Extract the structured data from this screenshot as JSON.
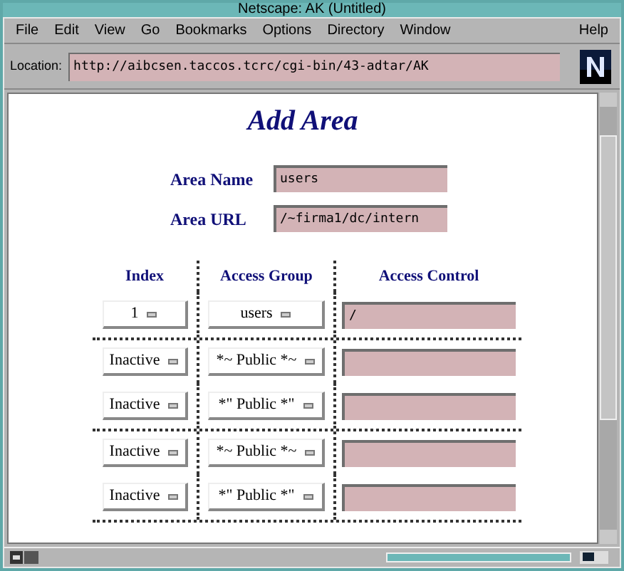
{
  "window": {
    "title": "Netscape: AK (Untitled)"
  },
  "menu": [
    "File",
    "Edit",
    "View",
    "Go",
    "Bookmarks",
    "Options",
    "Directory",
    "Window",
    "Help"
  ],
  "location": {
    "label": "Location:",
    "value": "http://aibcsen.taccos.tcrc/cgi-bin/43-adtar/AK"
  },
  "page": {
    "heading": "Add Area",
    "fields": [
      {
        "label": "Area Name",
        "value": "users"
      },
      {
        "label": "Area URL",
        "value": "/~firma1/dc/intern"
      }
    ],
    "table": {
      "columns": [
        "Index",
        "Access Group",
        "Access Control"
      ],
      "rows": [
        {
          "index": "1",
          "group": "users",
          "control": "/",
          "separator": false
        },
        {
          "index": "Inactive",
          "group": "*~ Public *~",
          "control": "",
          "separator": true
        },
        {
          "index": "Inactive",
          "group": "*\" Public *\"",
          "control": "",
          "separator": false
        },
        {
          "index": "Inactive",
          "group": "*~ Public *~",
          "control": "",
          "separator": true
        },
        {
          "index": "Inactive",
          "group": "*\" Public *\"",
          "control": "",
          "separator": false
        }
      ]
    }
  }
}
